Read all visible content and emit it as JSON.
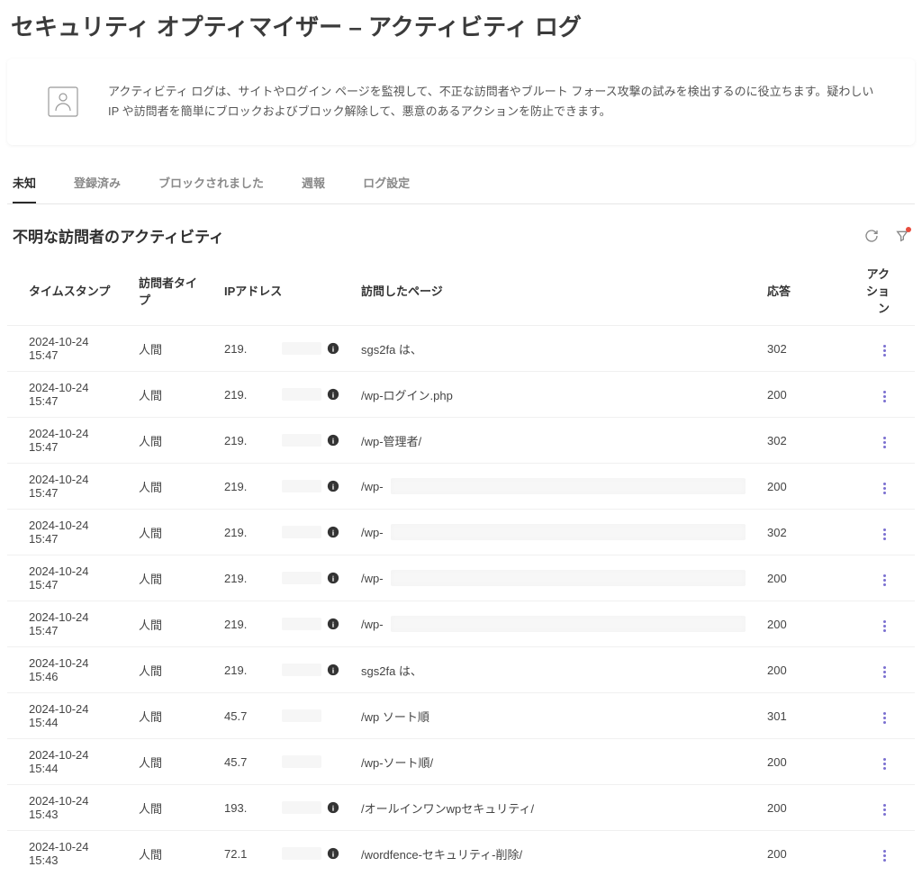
{
  "page_title": "セキュリティ オプティマイザー – アクティビティ ログ",
  "info_text": "アクティビティ ログは、サイトやログイン ページを監視して、不正な訪問者やブルート フォース攻撃の試みを検出するのに役立ちます。疑わしい IP や訪問者を簡単にブロックおよびブロック解除して、悪意のあるアクションを防止できます。",
  "tabs": [
    {
      "label": "未知",
      "active": true
    },
    {
      "label": "登録済み",
      "active": false
    },
    {
      "label": "ブロックされました",
      "active": false
    },
    {
      "label": "週報",
      "active": false
    },
    {
      "label": "ログ設定",
      "active": false
    }
  ],
  "section_title": "不明な訪問者のアクティビティ",
  "columns": {
    "timestamp": "タイムスタンプ",
    "visitor_type": "訪問者タイプ",
    "ip": "IPアドレス",
    "page": "訪問したページ",
    "response": "応答",
    "action": "アクション"
  },
  "rows": [
    {
      "timestamp": "2024-10-24 15:47",
      "visitor_type": "人間",
      "ip_prefix": "219.",
      "has_info": true,
      "page": "sgs2fa は、",
      "page_redacted": false,
      "response": "302"
    },
    {
      "timestamp": "2024-10-24 15:47",
      "visitor_type": "人間",
      "ip_prefix": "219.",
      "has_info": true,
      "page": "/wp-ログイン.php",
      "page_redacted": false,
      "response": "200"
    },
    {
      "timestamp": "2024-10-24 15:47",
      "visitor_type": "人間",
      "ip_prefix": "219.",
      "has_info": true,
      "page": "/wp-管理者/",
      "page_redacted": false,
      "response": "302"
    },
    {
      "timestamp": "2024-10-24 15:47",
      "visitor_type": "人間",
      "ip_prefix": "219.",
      "has_info": true,
      "page": "/wp-",
      "page_redacted": true,
      "response": "200"
    },
    {
      "timestamp": "2024-10-24 15:47",
      "visitor_type": "人間",
      "ip_prefix": "219.",
      "has_info": true,
      "page": "/wp-",
      "page_redacted": true,
      "response": "302"
    },
    {
      "timestamp": "2024-10-24 15:47",
      "visitor_type": "人間",
      "ip_prefix": "219.",
      "has_info": true,
      "page": "/wp-",
      "page_redacted": true,
      "response": "200"
    },
    {
      "timestamp": "2024-10-24 15:47",
      "visitor_type": "人間",
      "ip_prefix": "219.",
      "has_info": true,
      "page": "/wp-",
      "page_redacted": true,
      "response": "200"
    },
    {
      "timestamp": "2024-10-24 15:46",
      "visitor_type": "人間",
      "ip_prefix": "219.",
      "has_info": true,
      "page": "sgs2fa は、",
      "page_redacted": false,
      "response": "200"
    },
    {
      "timestamp": "2024-10-24 15:44",
      "visitor_type": "人間",
      "ip_prefix": "45.7",
      "has_info": false,
      "page": "/wp ソート順",
      "page_redacted": false,
      "response": "301"
    },
    {
      "timestamp": "2024-10-24 15:44",
      "visitor_type": "人間",
      "ip_prefix": "45.7",
      "has_info": false,
      "page": "/wp-ソート順/",
      "page_redacted": false,
      "response": "200"
    },
    {
      "timestamp": "2024-10-24 15:43",
      "visitor_type": "人間",
      "ip_prefix": "193.",
      "has_info": true,
      "page": "/オールインワンwpセキュリティ/",
      "page_redacted": false,
      "response": "200"
    },
    {
      "timestamp": "2024-10-24 15:43",
      "visitor_type": "人間",
      "ip_prefix": "72.1",
      "has_info": true,
      "page": "/wordfence-セキュリティ-削除/",
      "page_redacted": false,
      "response": "200"
    }
  ]
}
